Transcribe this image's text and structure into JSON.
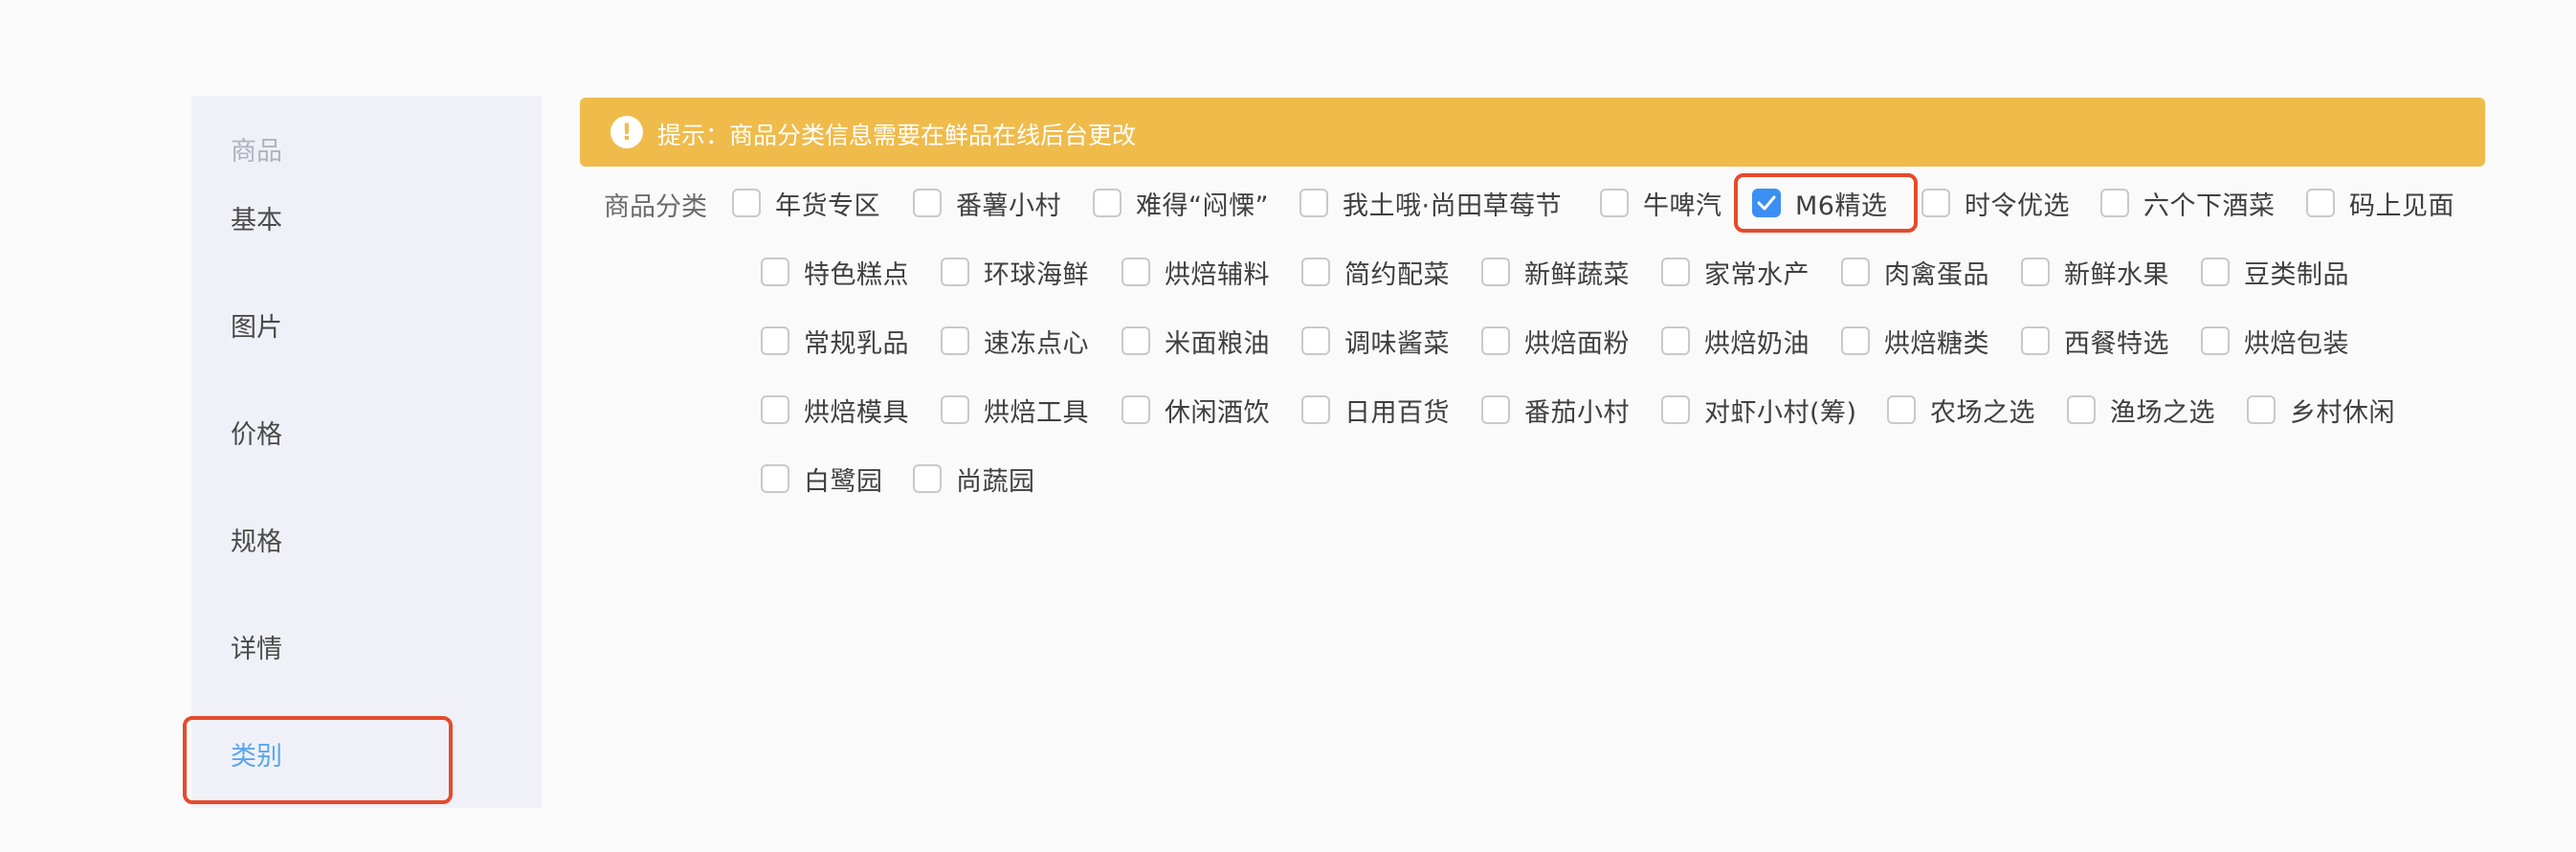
{
  "sidebar": {
    "title": "商品",
    "items": [
      {
        "label": "基本",
        "active": false
      },
      {
        "label": "图片",
        "active": false
      },
      {
        "label": "价格",
        "active": false
      },
      {
        "label": "规格",
        "active": false
      },
      {
        "label": "详情",
        "active": false
      },
      {
        "label": "类别",
        "active": true
      }
    ]
  },
  "hint": {
    "icon": "exclamation-icon",
    "text": "提示：商品分类信息需要在鲜品在线后台更改"
  },
  "category": {
    "label": "商品分类",
    "rows": [
      [
        {
          "label": "年货专区",
          "checked": false
        },
        {
          "label": "番薯小村",
          "checked": false
        },
        {
          "label": "难得“闷慄”",
          "checked": false
        },
        {
          "label": "我土哦·尚田草莓节",
          "checked": false
        },
        {
          "label": "牛啤汽",
          "checked": false
        },
        {
          "label": "M6精选",
          "checked": true
        },
        {
          "label": "时令优选",
          "checked": false
        },
        {
          "label": "六个下酒菜",
          "checked": false
        },
        {
          "label": "码上见面",
          "checked": false
        }
      ],
      [
        {
          "label": "特色糕点",
          "checked": false
        },
        {
          "label": "环球海鲜",
          "checked": false
        },
        {
          "label": "烘焙辅料",
          "checked": false
        },
        {
          "label": "简约配菜",
          "checked": false
        },
        {
          "label": "新鲜蔬菜",
          "checked": false
        },
        {
          "label": "家常水产",
          "checked": false
        },
        {
          "label": "肉禽蛋品",
          "checked": false
        },
        {
          "label": "新鲜水果",
          "checked": false
        },
        {
          "label": "豆类制品",
          "checked": false
        }
      ],
      [
        {
          "label": "常规乳品",
          "checked": false
        },
        {
          "label": "速冻点心",
          "checked": false
        },
        {
          "label": "米面粮油",
          "checked": false
        },
        {
          "label": "调味酱菜",
          "checked": false
        },
        {
          "label": "烘焙面粉",
          "checked": false
        },
        {
          "label": "烘焙奶油",
          "checked": false
        },
        {
          "label": "烘焙糖类",
          "checked": false
        },
        {
          "label": "西餐特选",
          "checked": false
        },
        {
          "label": "烘焙包装",
          "checked": false
        }
      ],
      [
        {
          "label": "烘焙模具",
          "checked": false
        },
        {
          "label": "烘焙工具",
          "checked": false
        },
        {
          "label": "休闲酒饮",
          "checked": false
        },
        {
          "label": "日用百货",
          "checked": false
        },
        {
          "label": "番茄小村",
          "checked": false
        },
        {
          "label": "对虾小村(筹)",
          "checked": false
        },
        {
          "label": "农场之选",
          "checked": false
        },
        {
          "label": "渔场之选",
          "checked": false
        },
        {
          "label": "乡村休闲",
          "checked": false
        }
      ],
      [
        {
          "label": "白鹭园",
          "checked": false
        },
        {
          "label": "尚蔬园",
          "checked": false
        }
      ]
    ]
  },
  "colors": {
    "accent": "#3b8ff3",
    "hint_bg": "#efbb4b",
    "highlight": "#e64a2a",
    "active_nav": "#58a6ee"
  }
}
